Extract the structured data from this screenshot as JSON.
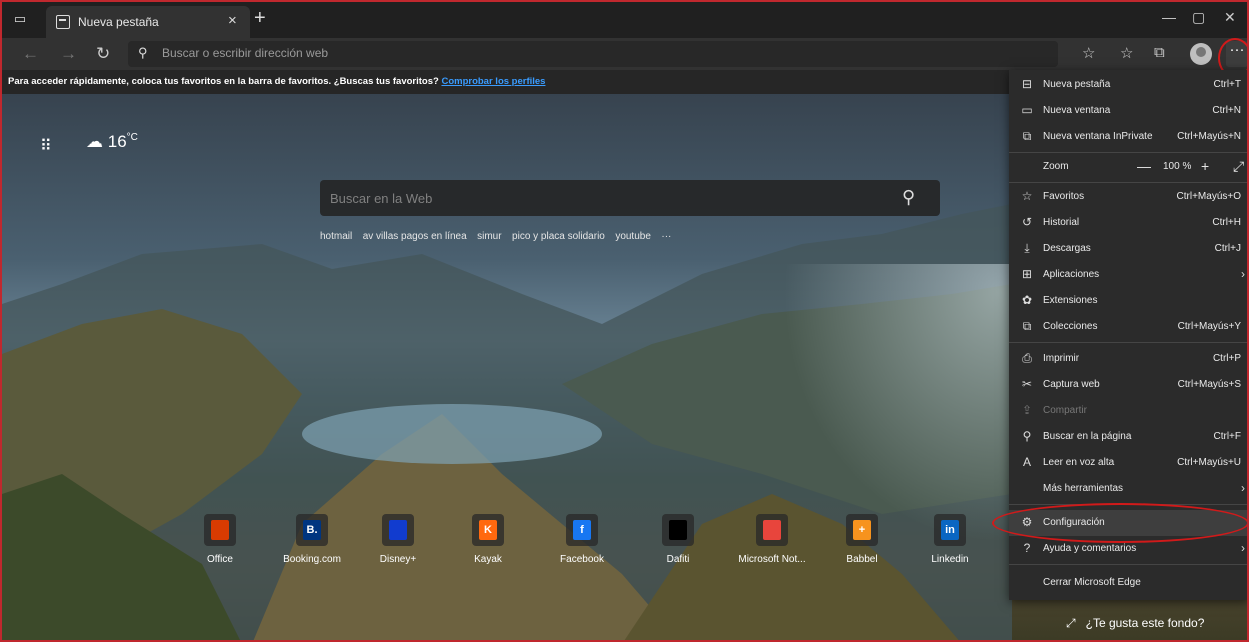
{
  "tab": {
    "title": "Nueva pestaña"
  },
  "address": {
    "placeholder": "Buscar o escribir dirección web"
  },
  "favbar": {
    "text": "Para acceder rápidamente, coloca tus favoritos en la barra de favoritos. ¿Buscas tus favoritos?",
    "link": "Comprobar los perfiles"
  },
  "newtab_page": {
    "weather_temp": "16",
    "weather_unit": "°C",
    "search_placeholder": "Buscar en la Web",
    "quick_links": [
      "hotmail",
      "av villas pagos en línea",
      "simur",
      "pico y placa solidario",
      "youtube",
      "···"
    ],
    "tiles": [
      {
        "label": "Office",
        "color": "#d83b01",
        "glyph": ""
      },
      {
        "label": "Booking.com",
        "color": "#003580",
        "glyph": "B."
      },
      {
        "label": "Disney+",
        "color": "#113ccf",
        "glyph": ""
      },
      {
        "label": "Kayak",
        "color": "#ff690f",
        "glyph": "K"
      },
      {
        "label": "Facebook",
        "color": "#1877f2",
        "glyph": "f"
      },
      {
        "label": "Dafiti",
        "color": "#000000",
        "glyph": ""
      },
      {
        "label": "Microsoft Not...",
        "color": "#e8453c",
        "glyph": ""
      },
      {
        "label": "Babbel",
        "color": "#f7931e",
        "glyph": "+"
      },
      {
        "label": "Linkedin",
        "color": "#0a66c2",
        "glyph": "in"
      }
    ],
    "like_background": "¿Te gusta este fondo?"
  },
  "menu": {
    "items": [
      {
        "label": "Nueva pestaña",
        "shortcut": "Ctrl+T"
      },
      {
        "label": "Nueva ventana",
        "shortcut": "Ctrl+N"
      },
      {
        "label": "Nueva ventana InPrivate",
        "shortcut": "Ctrl+Mayús+N"
      },
      {
        "label": "Zoom",
        "shortcut": ""
      },
      {
        "label": "Favoritos",
        "shortcut": "Ctrl+Mayús+O"
      },
      {
        "label": "Historial",
        "shortcut": "Ctrl+H"
      },
      {
        "label": "Descargas",
        "shortcut": "Ctrl+J"
      },
      {
        "label": "Aplicaciones",
        "shortcut": ""
      },
      {
        "label": "Extensiones",
        "shortcut": ""
      },
      {
        "label": "Colecciones",
        "shortcut": "Ctrl+Mayús+Y"
      },
      {
        "label": "Imprimir",
        "shortcut": "Ctrl+P"
      },
      {
        "label": "Captura web",
        "shortcut": "Ctrl+Mayús+S"
      },
      {
        "label": "Compartir",
        "shortcut": ""
      },
      {
        "label": "Buscar en la página",
        "shortcut": "Ctrl+F"
      },
      {
        "label": "Leer en voz alta",
        "shortcut": "Ctrl+Mayús+U"
      },
      {
        "label": "Más herramientas",
        "shortcut": ""
      },
      {
        "label": "Configuración",
        "shortcut": ""
      },
      {
        "label": "Ayuda y comentarios",
        "shortcut": ""
      },
      {
        "label": "Cerrar Microsoft Edge",
        "shortcut": ""
      }
    ],
    "zoom_value": "100 %"
  }
}
